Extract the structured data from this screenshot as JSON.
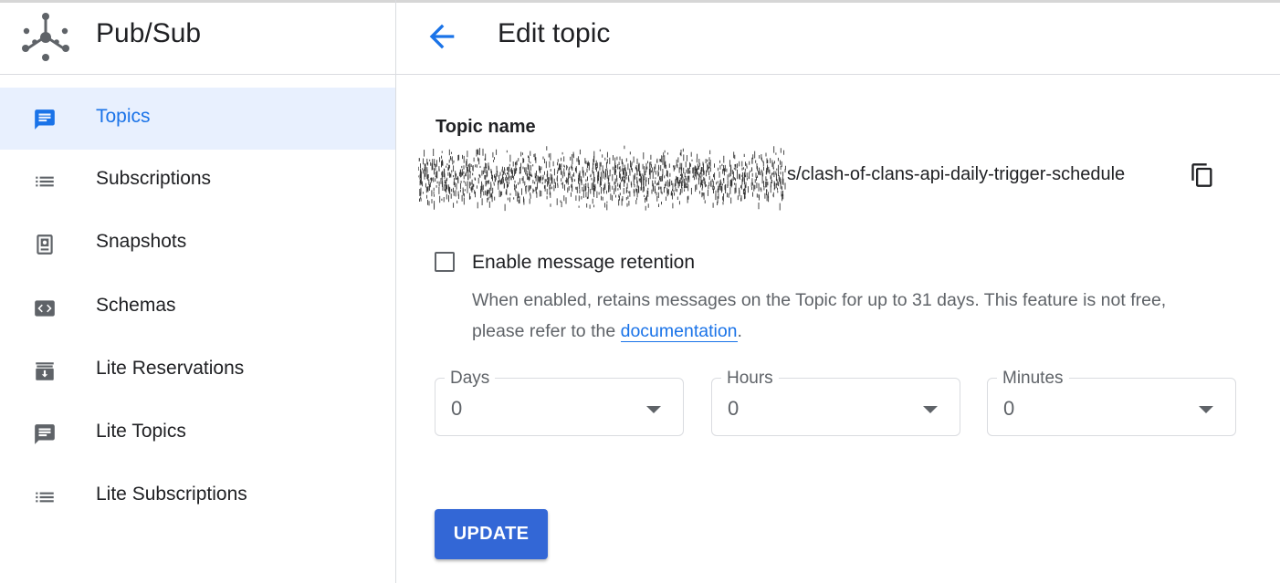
{
  "app": {
    "title": "Pub/Sub",
    "logo_icon": "pubsub-logo-icon"
  },
  "sidebar": {
    "items": [
      {
        "label": "Topics",
        "icon": "topic-chat-icon",
        "active": true
      },
      {
        "label": "Subscriptions",
        "icon": "list-icon",
        "active": false
      },
      {
        "label": "Snapshots",
        "icon": "snapshot-icon",
        "active": false
      },
      {
        "label": "Schemas",
        "icon": "schema-code-icon",
        "active": false
      },
      {
        "label": "Lite Reservations",
        "icon": "reservation-icon",
        "active": false
      },
      {
        "label": "Lite Topics",
        "icon": "topic-chat-icon",
        "active": false
      },
      {
        "label": "Lite Subscriptions",
        "icon": "list-icon",
        "active": false
      }
    ]
  },
  "header": {
    "back_icon": "arrow-back-icon",
    "title": "Edit topic"
  },
  "form": {
    "topic_name_label": "Topic name",
    "topic_name_value": "s/clash-of-clans-api-daily-trigger-schedule",
    "copy_icon": "copy-icon",
    "retention": {
      "checkbox_label": "Enable message retention",
      "checked": false,
      "help_text_before": "When enabled, retains messages on the Topic for up to 31 days. This feature is not free, please refer to the",
      "help_link": "documentation",
      "help_text_after": "."
    },
    "fields": [
      {
        "label": "Days",
        "value": "0"
      },
      {
        "label": "Hours",
        "value": "0"
      },
      {
        "label": "Minutes",
        "value": "0"
      }
    ],
    "submit_label": "UPDATE"
  },
  "colors": {
    "accent": "#1a73e8",
    "active_bg": "#e8f0fe",
    "button": "#3367d6",
    "muted_text": "#5f6368"
  }
}
